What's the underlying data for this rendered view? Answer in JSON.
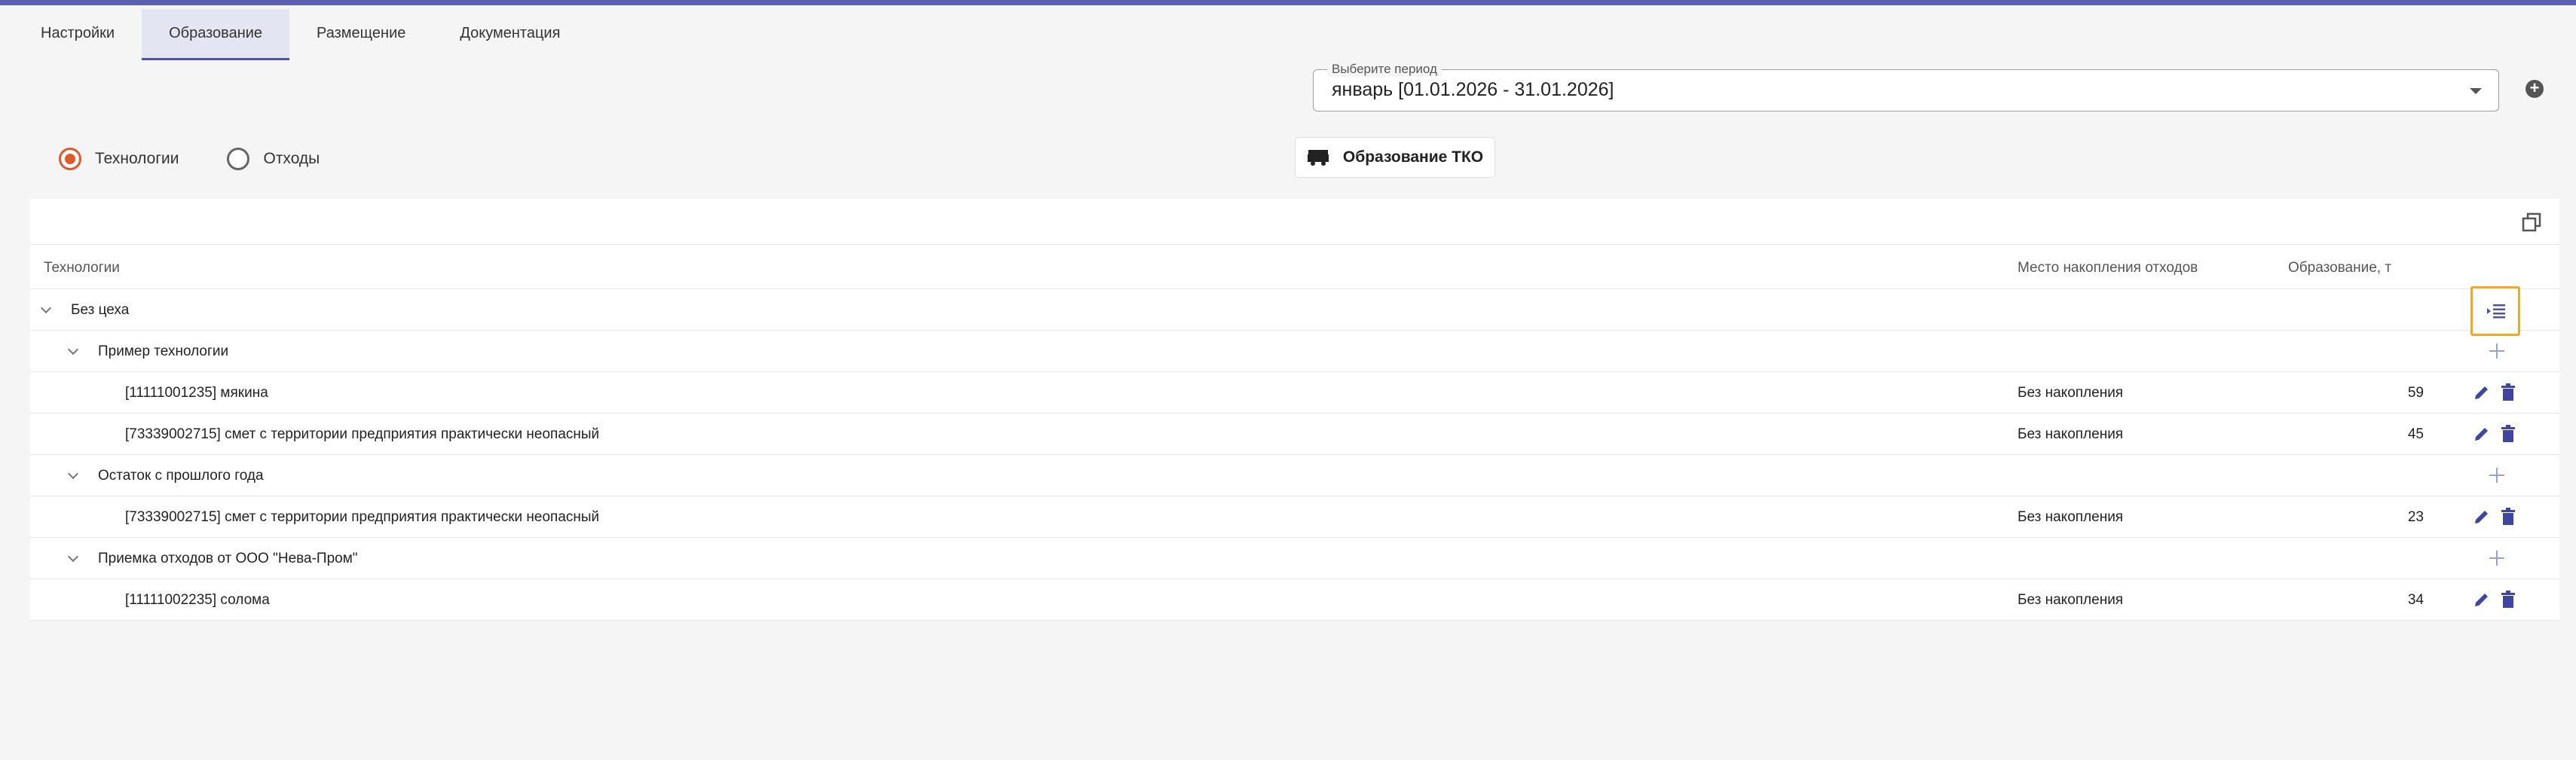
{
  "tabs": [
    {
      "label": "Настройки",
      "active": false
    },
    {
      "label": "Образование",
      "active": true
    },
    {
      "label": "Размещение",
      "active": false
    },
    {
      "label": "Документация",
      "active": false
    }
  ],
  "period": {
    "label": "Выберите период",
    "value": "январь [01.01.2026 - 31.01.2026]"
  },
  "radios": [
    {
      "label": "Технологии",
      "checked": true
    },
    {
      "label": "Отходы",
      "checked": false
    }
  ],
  "tko_button": {
    "label": "Образование ТКО",
    "icon": "truck-icon"
  },
  "table": {
    "columns": {
      "tech": "Технологии",
      "place": "Место накопления отходов",
      "amount": "Образование, т"
    },
    "rows": [
      {
        "level": 0,
        "text": "Без цеха",
        "place": "",
        "amount": "",
        "action": "expand"
      },
      {
        "level": 1,
        "text": "Пример технологии",
        "place": "",
        "amount": "",
        "action": "add"
      },
      {
        "level": 2,
        "text": "[11111001235] мякина",
        "place": "Без накопления",
        "amount": "59",
        "action": "edit"
      },
      {
        "level": 2,
        "text": "[73339002715] смет с территории предприятия практически неопасный",
        "place": "Без накопления",
        "amount": "45",
        "action": "edit"
      },
      {
        "level": 1,
        "text": "Остаток с прошлого года",
        "place": "",
        "amount": "",
        "action": "add"
      },
      {
        "level": 2,
        "text": "[73339002715] смет с территории предприятия практически неопасный",
        "place": "Без накопления",
        "amount": "23",
        "action": "edit"
      },
      {
        "level": 1,
        "text": "Приемка отходов от ООО \"Нева-Пром\"",
        "place": "",
        "amount": "",
        "action": "add"
      },
      {
        "level": 2,
        "text": "[11111002235] солома",
        "place": "Без накопления",
        "amount": "34",
        "action": "edit"
      }
    ]
  },
  "colors": {
    "accent": "#4b53a3",
    "radio": "#e0592a",
    "highlight": "#f5a623",
    "icon": "#4b53a3"
  }
}
